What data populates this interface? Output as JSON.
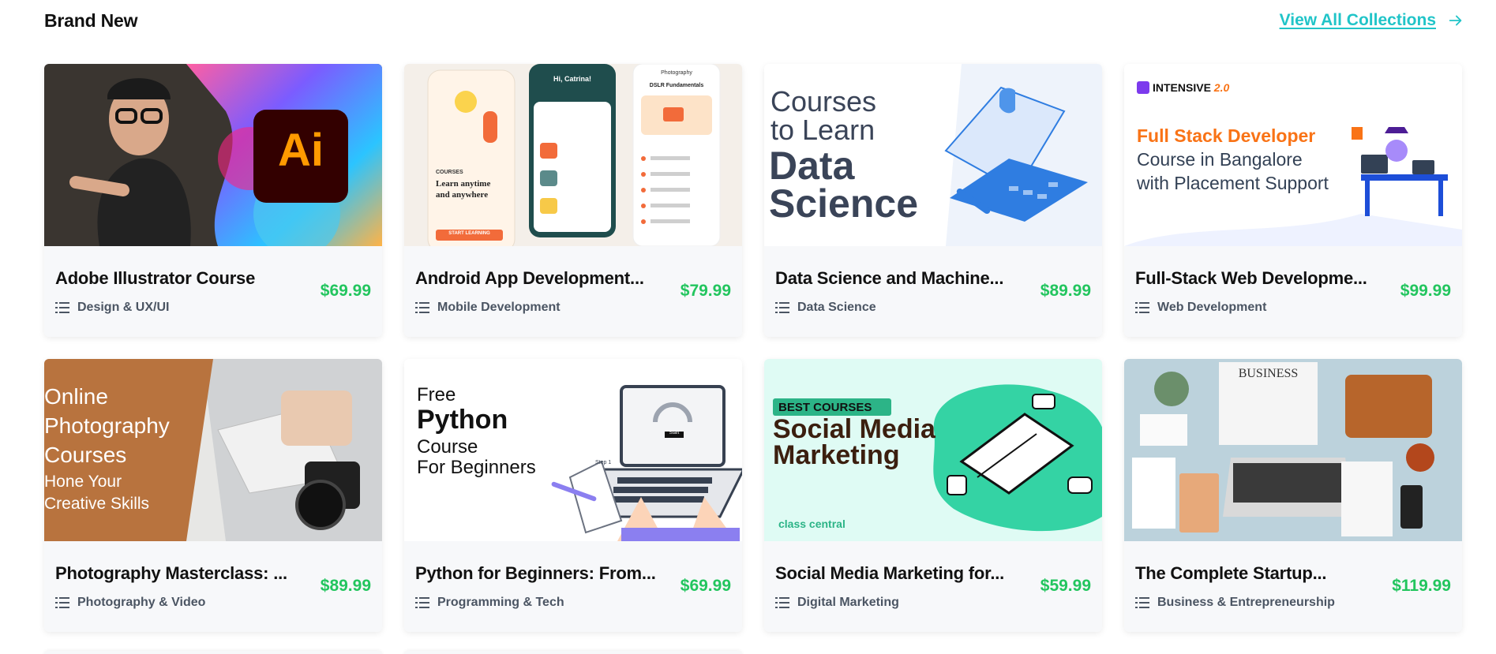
{
  "section": {
    "title": "Brand New",
    "view_all": "View All Collections"
  },
  "cards": [
    {
      "title": "Adobe Illustrator Course",
      "category": "Design & UX/UI",
      "price": "$69.99",
      "thumb_text": [
        "Ai"
      ]
    },
    {
      "title": "Android App Development...",
      "category": "Mobile Development",
      "price": "$79.99",
      "thumb_text": [
        "Hi, Catrina!",
        "COURSES",
        "Learn anytime",
        "and anywhere",
        "START LEARNING",
        "Photography",
        "DSLR Fundamentals"
      ]
    },
    {
      "title": "Data Science and Machine...",
      "category": "Data Science",
      "price": "$89.99",
      "thumb_text": [
        "Courses",
        "to Learn",
        "Data",
        "Science"
      ]
    },
    {
      "title": "Full-Stack Web Developme...",
      "category": "Web Development",
      "price": "$99.99",
      "thumb_text": [
        "INTENSIVE",
        "2.0",
        "Full Stack Developer",
        "Course in Bangalore",
        "with Placement Support"
      ]
    },
    {
      "title": "Photography Masterclass: ...",
      "category": "Photography & Video",
      "price": "$89.99",
      "thumb_text": [
        "Online",
        "Photography",
        "Courses",
        "Hone Your",
        "Creative Skills"
      ]
    },
    {
      "title": "Python for Beginners: From...",
      "category": "Programming & Tech",
      "price": "$69.99",
      "thumb_text": [
        "Free",
        "Python",
        "Course",
        "For Beginners",
        "Start",
        "Step 1"
      ]
    },
    {
      "title": "Social Media Marketing for...",
      "category": "Digital Marketing",
      "price": "$59.99",
      "thumb_text": [
        "BEST COURSES",
        "Social Media",
        "Marketing",
        "class central"
      ]
    },
    {
      "title": "The Complete Startup...",
      "category": "Business & Entrepreneurship",
      "price": "$119.99",
      "thumb_text": [
        "BUSINESS"
      ]
    }
  ],
  "colors": {
    "accent": "#20c4c8",
    "price": "#22c55e"
  },
  "icons": {
    "view_all": "arrow-right-icon",
    "category": "list-icon"
  }
}
